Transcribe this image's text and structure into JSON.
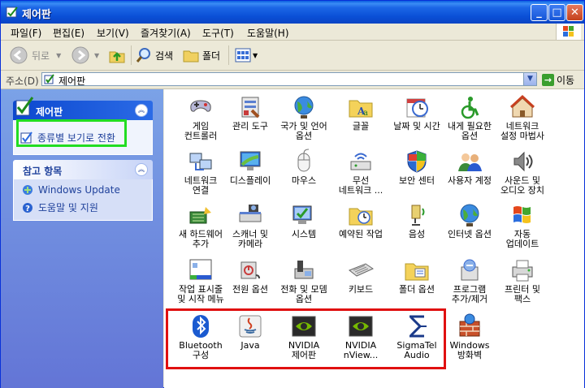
{
  "window": {
    "title": "제어판"
  },
  "menu": [
    "파일(F)",
    "편집(E)",
    "보기(V)",
    "즐겨찾기(A)",
    "도구(T)",
    "도움말(H)"
  ],
  "toolbar": {
    "back": "뒤로",
    "search": "검색",
    "folders": "폴더"
  },
  "address": {
    "label": "주소(D)",
    "value": "제어판",
    "go": "이동"
  },
  "sidebar": {
    "control_panel": {
      "title": "제어판",
      "switch_link": "종류별 보기로 전환"
    },
    "see_also": {
      "title": "참고 항목",
      "links": [
        "Windows Update",
        "도움말 및 지원"
      ]
    }
  },
  "items": [
    {
      "label": "게임\n컨트롤러",
      "icon": "game-controller-icon"
    },
    {
      "label": "관리 도구",
      "icon": "admin-tools-icon"
    },
    {
      "label": "국가 및 언어\n옵션",
      "icon": "globe-icon"
    },
    {
      "label": "글꼴",
      "icon": "fonts-folder-icon"
    },
    {
      "label": "날짜 및 시간",
      "icon": "clock-icon"
    },
    {
      "label": "내게 필요한\n옵션",
      "icon": "accessibility-icon"
    },
    {
      "label": "네트워크\n설정 마법사",
      "icon": "network-home-icon"
    },
    {
      "label": "네트워크\n연결",
      "icon": "network-connection-icon"
    },
    {
      "label": "디스플레이",
      "icon": "display-icon"
    },
    {
      "label": "마우스",
      "icon": "mouse-icon"
    },
    {
      "label": "무선\n네트워크 ...",
      "icon": "wireless-icon"
    },
    {
      "label": "보안 센터",
      "icon": "shield-icon"
    },
    {
      "label": "사용자 계정",
      "icon": "users-icon"
    },
    {
      "label": "사운드 및\n오디오 장치",
      "icon": "speaker-icon"
    },
    {
      "label": "새 하드웨어\n추가",
      "icon": "hardware-icon"
    },
    {
      "label": "스캐너 및\n카메라",
      "icon": "scanner-icon"
    },
    {
      "label": "시스템",
      "icon": "system-icon"
    },
    {
      "label": "예약된 작업",
      "icon": "scheduled-tasks-icon"
    },
    {
      "label": "음성",
      "icon": "speech-icon"
    },
    {
      "label": "인터넷 옵션",
      "icon": "internet-globe-icon"
    },
    {
      "label": "자동\n업데이트",
      "icon": "windows-flag-icon"
    },
    {
      "label": "작업 표시줄\n및 시작 메뉴",
      "icon": "taskbar-icon"
    },
    {
      "label": "전원 옵션",
      "icon": "power-icon"
    },
    {
      "label": "전화 및 모뎀\n옵션",
      "icon": "phone-icon"
    },
    {
      "label": "키보드",
      "icon": "keyboard-icon"
    },
    {
      "label": "폴더 옵션",
      "icon": "folder-options-icon"
    },
    {
      "label": "프로그램\n추가/제거",
      "icon": "add-remove-icon"
    },
    {
      "label": "프린터 및\n팩스",
      "icon": "printer-icon"
    },
    {
      "label": "Bluetooth\n구성",
      "icon": "bluetooth-icon"
    },
    {
      "label": "Java",
      "icon": "java-icon"
    },
    {
      "label": "NVIDIA\n제어판",
      "icon": "nvidia-icon"
    },
    {
      "label": "NVIDIA\nnView...",
      "icon": "nvidia-icon"
    },
    {
      "label": "SigmaTel\nAudio",
      "icon": "sigmatel-icon"
    },
    {
      "label": "Windows\n방화벽",
      "icon": "firewall-icon"
    }
  ]
}
